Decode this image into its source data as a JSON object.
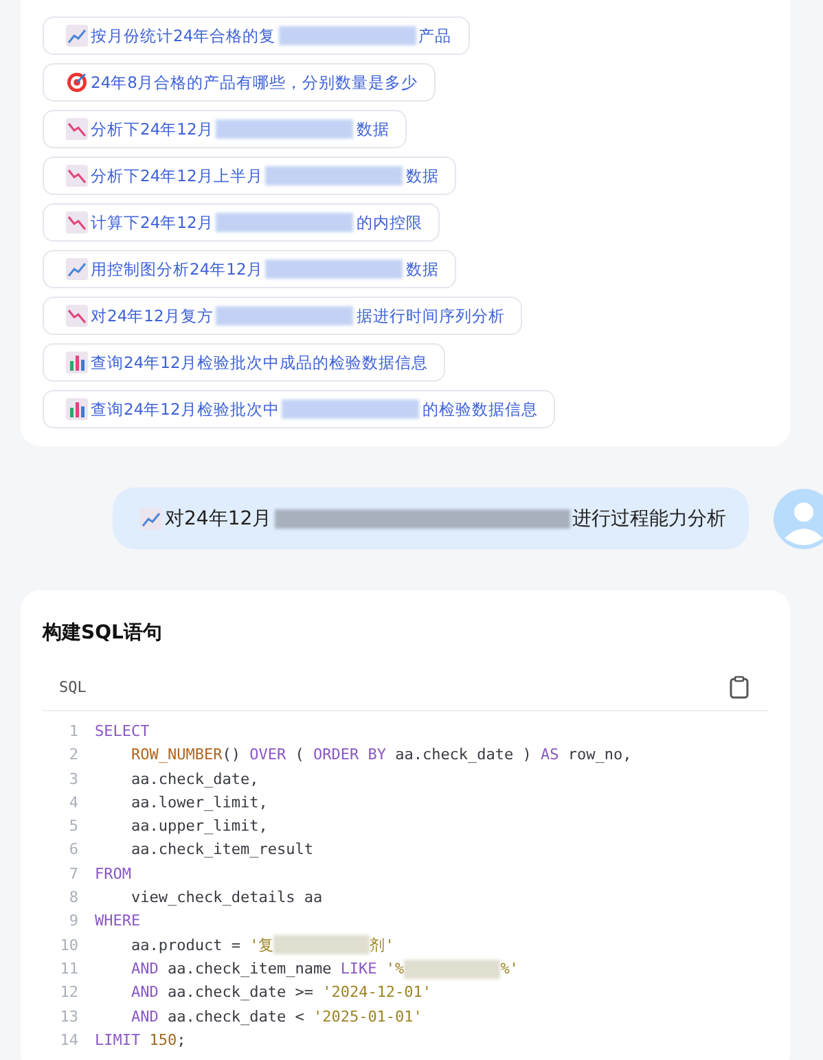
{
  "suggestions": [
    {
      "kind": "trend-up",
      "parts": [
        {
          "kind": "text",
          "text": "按月份统计24年合格的复"
        },
        {
          "kind": "redacted"
        },
        {
          "kind": "text",
          "text": "产品"
        }
      ]
    },
    {
      "kind": "target",
      "parts": [
        {
          "kind": "text",
          "text": "24年8月合格的产品有哪些，分别数量是多少"
        }
      ]
    },
    {
      "kind": "trend-down",
      "parts": [
        {
          "kind": "text",
          "text": "分析下24年12月"
        },
        {
          "kind": "redacted"
        },
        {
          "kind": "text",
          "text": "数据"
        }
      ]
    },
    {
      "kind": "trend-down",
      "parts": [
        {
          "kind": "text",
          "text": "分析下24年12月上半月"
        },
        {
          "kind": "redacted"
        },
        {
          "kind": "text",
          "text": "数据"
        }
      ]
    },
    {
      "kind": "trend-down",
      "parts": [
        {
          "kind": "text",
          "text": "计算下24年12月"
        },
        {
          "kind": "redacted"
        },
        {
          "kind": "text",
          "text": "的内控限"
        }
      ]
    },
    {
      "kind": "trend-up",
      "parts": [
        {
          "kind": "text",
          "text": "用控制图分析24年12月"
        },
        {
          "kind": "redacted"
        },
        {
          "kind": "text",
          "text": "数据"
        }
      ]
    },
    {
      "kind": "trend-down",
      "parts": [
        {
          "kind": "text",
          "text": "对24年12月复方"
        },
        {
          "kind": "redacted"
        },
        {
          "kind": "text",
          "text": "据进行时间序列分析"
        }
      ]
    },
    {
      "kind": "bar",
      "parts": [
        {
          "kind": "text",
          "text": "查询24年12月检验批次中成品的检验数据信息"
        }
      ]
    },
    {
      "kind": "bar",
      "parts": [
        {
          "kind": "text",
          "text": "查询24年12月检验批次中"
        },
        {
          "kind": "redacted"
        },
        {
          "kind": "text",
          "text": "的检验数据信息"
        }
      ]
    }
  ],
  "user_message": {
    "kind": "trend-up",
    "parts": [
      {
        "kind": "text",
        "text": "对24年12月"
      },
      {
        "kind": "redacted"
      },
      {
        "kind": "text",
        "text": "进行过程能力分析"
      }
    ]
  },
  "sql_card": {
    "title": "构建SQL语句",
    "language": "SQL",
    "lines": [
      {
        "no": "1",
        "tokens": [
          {
            "kind": "kw",
            "text": "SELECT"
          }
        ]
      },
      {
        "no": "2",
        "tokens": [
          {
            "kind": "fn",
            "text": "    ROW_NUMBER"
          },
          {
            "kind": "plain",
            "text": "() "
          },
          {
            "kind": "kw",
            "text": "OVER"
          },
          {
            "kind": "plain",
            "text": " ( "
          },
          {
            "kind": "kw",
            "text": "ORDER BY"
          },
          {
            "kind": "plain",
            "text": " aa.check_date ) "
          },
          {
            "kind": "kw",
            "text": "AS"
          },
          {
            "kind": "plain",
            "text": " row_no,"
          }
        ]
      },
      {
        "no": "3",
        "tokens": [
          {
            "kind": "plain",
            "text": "    aa.check_date,"
          }
        ]
      },
      {
        "no": "4",
        "tokens": [
          {
            "kind": "plain",
            "text": "    aa.lower_limit,"
          }
        ]
      },
      {
        "no": "5",
        "tokens": [
          {
            "kind": "plain",
            "text": "    aa.upper_limit,"
          }
        ]
      },
      {
        "no": "6",
        "tokens": [
          {
            "kind": "plain",
            "text": "    aa.check_item_result"
          }
        ]
      },
      {
        "no": "7",
        "tokens": [
          {
            "kind": "kw",
            "text": "FROM"
          }
        ]
      },
      {
        "no": "8",
        "tokens": [
          {
            "kind": "plain",
            "text": "    view_check_details aa"
          }
        ]
      },
      {
        "no": "9",
        "tokens": [
          {
            "kind": "kw",
            "text": "WHERE"
          }
        ]
      },
      {
        "no": "10",
        "tokens": [
          {
            "kind": "plain",
            "text": "    aa.product = "
          },
          {
            "kind": "str",
            "text": "'复"
          },
          {
            "kind": "redacted"
          },
          {
            "kind": "str",
            "text": "剂'"
          }
        ]
      },
      {
        "no": "11",
        "tokens": [
          {
            "kind": "kw",
            "text": "    AND"
          },
          {
            "kind": "plain",
            "text": " aa.check_item_name "
          },
          {
            "kind": "kw",
            "text": "LIKE"
          },
          {
            "kind": "str",
            "text": " '%"
          },
          {
            "kind": "redacted"
          },
          {
            "kind": "str",
            "text": "%'"
          }
        ]
      },
      {
        "no": "12",
        "tokens": [
          {
            "kind": "kw",
            "text": "    AND"
          },
          {
            "kind": "plain",
            "text": " aa.check_date >= "
          },
          {
            "kind": "str",
            "text": "'2024-12-01'"
          }
        ]
      },
      {
        "no": "13",
        "tokens": [
          {
            "kind": "kw",
            "text": "    AND"
          },
          {
            "kind": "plain",
            "text": " aa.check_date < "
          },
          {
            "kind": "str",
            "text": "'2025-01-01'"
          }
        ]
      },
      {
        "no": "14",
        "tokens": [
          {
            "kind": "kw",
            "text": "LIMIT"
          },
          {
            "kind": "num",
            "text": " 150"
          },
          {
            "kind": "plain",
            "text": ";"
          }
        ]
      }
    ]
  }
}
